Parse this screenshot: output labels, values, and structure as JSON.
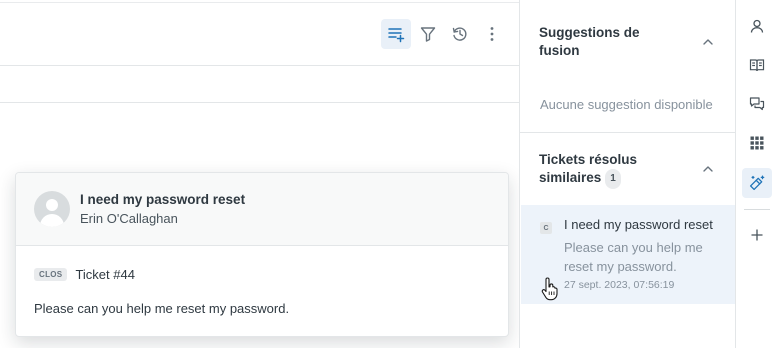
{
  "toolbar": {
    "icons": [
      "add-to-list-icon",
      "filter-icon",
      "history-icon",
      "more-vertical-icon"
    ],
    "accent_color": "#1f73b7"
  },
  "hover_card": {
    "title": "I need my password reset",
    "author": "Erin O'Callaghan",
    "status_badge": "CLOS",
    "ticket_number": "Ticket #44",
    "description": "Please can you help me reset my password."
  },
  "panel": {
    "merge_suggestions": {
      "title_line1": "Suggestions de",
      "title_line2": "fusion",
      "empty_text": "Aucune suggestion disponible"
    },
    "similar_tickets": {
      "title_line1": "Tickets résolus",
      "title_line2": "similaires",
      "count": "1",
      "items": [
        {
          "status_letter": "C",
          "title": "I need my password reset",
          "description": "Please can you help me reset my password.",
          "date": "27 sept. 2023, 07:56:19"
        }
      ]
    }
  },
  "rail": {
    "icons": [
      "user-icon",
      "knowledge-book-icon",
      "conversations-icon",
      "apps-grid-icon",
      "magic-wand-icon",
      "add-icon"
    ]
  }
}
